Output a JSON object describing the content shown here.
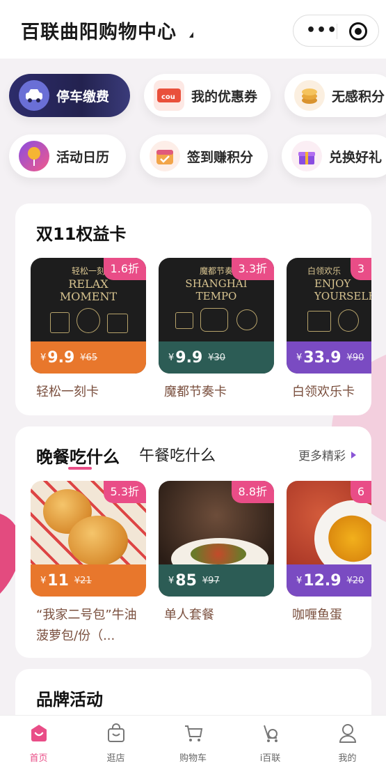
{
  "header": {
    "title": "百联曲阳购物中心"
  },
  "quick_actions": [
    {
      "label": "停车缴费",
      "icon": "car-icon"
    },
    {
      "label": "我的优惠券",
      "icon": "coupon-icon"
    },
    {
      "label": "无感积分",
      "icon": "coins-icon"
    },
    {
      "label": "活动日历",
      "icon": "calendar-balloon-icon"
    },
    {
      "label": "签到赚积分",
      "icon": "checkin-calendar-icon"
    },
    {
      "label": "兑换好礼",
      "icon": "gift-icon"
    }
  ],
  "benefit_card": {
    "title": "双11权益卡",
    "items": [
      {
        "cn": "轻松一刻",
        "en1": "RELAX",
        "en2": "MOMENT",
        "discount": "1.6折",
        "yen": "¥",
        "price": "9.9",
        "old_price": "¥65",
        "name": "轻松一刻卡"
      },
      {
        "cn": "魔都节奏",
        "en1": "SHANGHAI",
        "en2": "TEMPO",
        "discount": "3.3折",
        "yen": "¥",
        "price": "9.9",
        "old_price": "¥30",
        "name": "魔都节奏卡"
      },
      {
        "cn": "白领欢乐",
        "en1": "ENJOY",
        "en2": "YOURSELF",
        "discount": "3",
        "yen": "¥",
        "price": "33.9",
        "old_price": "¥90",
        "name": "白领欢乐卡"
      }
    ]
  },
  "dinner_card": {
    "tab_active": "晚餐吃什么",
    "tab_inactive": "午餐吃什么",
    "more": "更多精彩",
    "items": [
      {
        "discount": "5.3折",
        "yen": "¥",
        "price": "11",
        "old_price": "¥21",
        "name": "“我家二号包”牛油菠萝包/份（..."
      },
      {
        "discount": "8.8折",
        "yen": "¥",
        "price": "85",
        "old_price": "¥97",
        "name": "单人套餐"
      },
      {
        "discount": "6",
        "yen": "¥",
        "price": "12.9",
        "old_price": "¥20",
        "name": "咖喱鱼蛋"
      }
    ]
  },
  "brand_card": {
    "title": "品牌活动"
  },
  "tabbar": [
    {
      "label": "首页",
      "icon": "home-icon"
    },
    {
      "label": "逛店",
      "icon": "shopping-bag-icon"
    },
    {
      "label": "购物车",
      "icon": "cart-icon"
    },
    {
      "label": "i百联",
      "icon": "ibailian-icon"
    },
    {
      "label": "我的",
      "icon": "user-icon"
    }
  ],
  "colors": {
    "accent": "#e94d87",
    "orange": "#e8772c",
    "green": "#2c5c55",
    "purple": "#7a4bc2"
  }
}
